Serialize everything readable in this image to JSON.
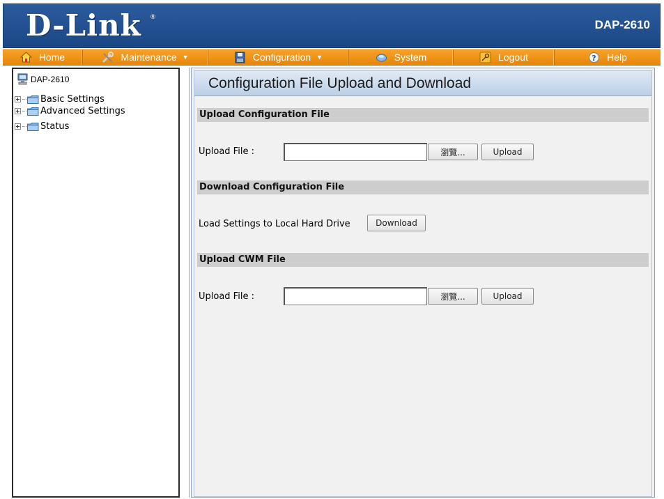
{
  "header": {
    "logo": "D-Link",
    "registered_mark": "®",
    "model": "DAP-2610"
  },
  "nav": {
    "items": [
      {
        "label": "Home",
        "icon": "home-icon",
        "dropdown": false
      },
      {
        "label": "Maintenance",
        "icon": "tools-icon",
        "dropdown": true
      },
      {
        "label": "Configuration",
        "icon": "disk-icon",
        "dropdown": true
      },
      {
        "label": "System",
        "icon": "system-icon",
        "dropdown": false
      },
      {
        "label": "Logout",
        "icon": "key-icon",
        "dropdown": false
      },
      {
        "label": "Help",
        "icon": "help-icon",
        "dropdown": false
      }
    ],
    "caret": "▼"
  },
  "tree": {
    "root": "DAP-2610",
    "items": [
      {
        "label": "Basic Settings"
      },
      {
        "label": "Advanced Settings"
      },
      {
        "label": "Status"
      }
    ]
  },
  "main": {
    "title": "Configuration File Upload and Download",
    "upload_config": {
      "heading": "Upload Configuration File",
      "label": "Upload File :",
      "value": "",
      "browse_label": "瀏覽...",
      "upload_label": "Upload"
    },
    "download_config": {
      "heading": "Download Configuration File",
      "label": "Load Settings to Local Hard Drive",
      "download_label": "Download"
    },
    "upload_cwm": {
      "heading": "Upload CWM File",
      "label": "Upload File :",
      "value": "",
      "browse_label": "瀏覽...",
      "upload_label": "Upload"
    }
  },
  "colors": {
    "header_blue": "#1f4d8c",
    "nav_orange": "#f39a1f",
    "section_gray": "#cdcdcd",
    "title_bar_blue": "#cfdcec"
  }
}
